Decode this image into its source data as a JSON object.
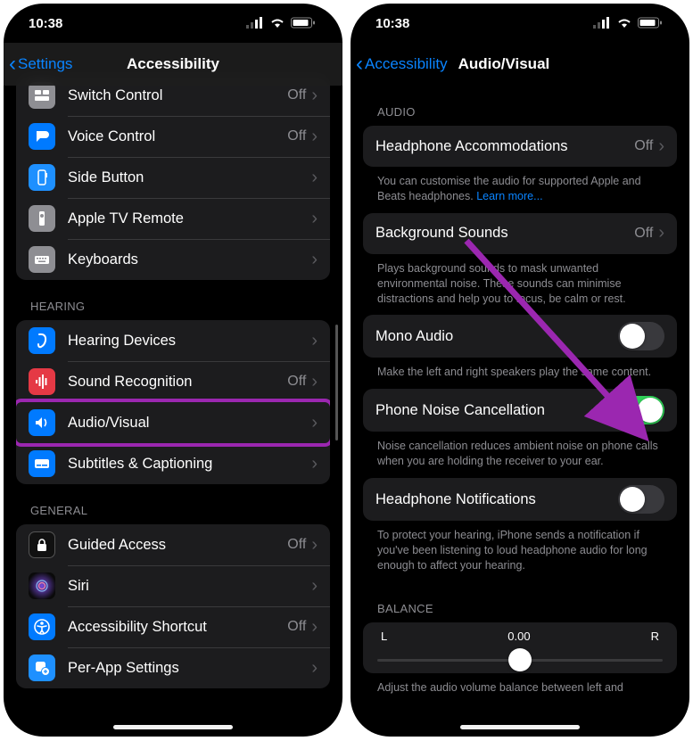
{
  "status": {
    "time": "10:38"
  },
  "panelA": {
    "back": "Settings",
    "title": "Accessibility",
    "topGroup": [
      {
        "key": "switch-control",
        "label": "Switch Control",
        "value": "Off",
        "iconColor": "gray"
      },
      {
        "key": "voice-control",
        "label": "Voice Control",
        "value": "Off",
        "iconColor": "blue"
      },
      {
        "key": "side-button",
        "label": "Side Button",
        "value": "",
        "iconColor": "lblue"
      },
      {
        "key": "apple-tv-remote",
        "label": "Apple TV Remote",
        "value": "",
        "iconColor": "gray"
      },
      {
        "key": "keyboards",
        "label": "Keyboards",
        "value": "",
        "iconColor": "gray"
      }
    ],
    "hearingHeader": "HEARING",
    "hearingGroup": [
      {
        "key": "hearing-devices",
        "label": "Hearing Devices",
        "value": "",
        "iconColor": "blue"
      },
      {
        "key": "sound-recognition",
        "label": "Sound Recognition",
        "value": "Off",
        "iconColor": "red"
      },
      {
        "key": "audio-visual",
        "label": "Audio/Visual",
        "value": "",
        "iconColor": "blue",
        "highlighted": true
      },
      {
        "key": "subtitles",
        "label": "Subtitles & Captioning",
        "value": "",
        "iconColor": "blue"
      }
    ],
    "generalHeader": "GENERAL",
    "generalGroup": [
      {
        "key": "guided-access",
        "label": "Guided Access",
        "value": "Off",
        "iconColor": "dark"
      },
      {
        "key": "siri",
        "label": "Siri",
        "value": "",
        "iconColor": "siri"
      },
      {
        "key": "accessibility-shortcut",
        "label": "Accessibility Shortcut",
        "value": "Off",
        "iconColor": "blue"
      },
      {
        "key": "per-app-settings",
        "label": "Per-App Settings",
        "value": "",
        "iconColor": "lblue"
      }
    ]
  },
  "panelB": {
    "back": "Accessibility",
    "title": "Audio/Visual",
    "audioHeader": "AUDIO",
    "headphoneAccom": {
      "label": "Headphone Accommodations",
      "value": "Off"
    },
    "headphoneFooter": "You can customise the audio for supported Apple and Beats headphones. ",
    "learnMore": "Learn more...",
    "bgSounds": {
      "label": "Background Sounds",
      "value": "Off"
    },
    "bgFooter": "Plays background sounds to mask unwanted environmental noise. These sounds can minimise distractions and help you to focus, be calm or rest.",
    "mono": {
      "label": "Mono Audio",
      "on": false
    },
    "monoFooter": "Make the left and right speakers play the same content.",
    "noise": {
      "label": "Phone Noise Cancellation",
      "on": true
    },
    "noiseFooter": "Noise cancellation reduces ambient noise on phone calls when you are holding the receiver to your ear.",
    "hpNotif": {
      "label": "Headphone Notifications",
      "on": false
    },
    "hpNotifFooter": "To protect your hearing, iPhone sends a notification if you've been listening to loud headphone audio for long enough to affect your hearing.",
    "balanceHeader": "BALANCE",
    "balance": {
      "left": "L",
      "right": "R",
      "value": "0.00"
    },
    "balanceFooter": "Adjust the audio volume balance between left and"
  }
}
